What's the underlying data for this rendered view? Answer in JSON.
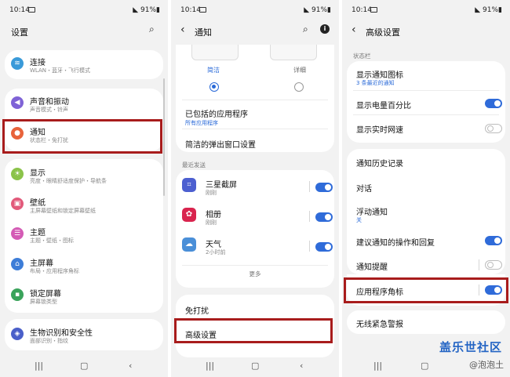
{
  "status": {
    "time": "10:14",
    "battery": "91%"
  },
  "panel1": {
    "title": "设置",
    "items": [
      {
        "icon": "wifi-icon",
        "color": "#3a9ad9",
        "title": "连接",
        "sub": "WLAN・蓝牙・飞行模式"
      },
      {
        "icon": "sound-icon",
        "color": "#7f63d6",
        "title": "声音和振动",
        "sub": "声音模式・铃声"
      },
      {
        "icon": "notification-icon",
        "color": "#e8633b",
        "title": "通知",
        "sub": "状态栏・免打扰"
      },
      {
        "icon": "display-icon",
        "color": "#8bc34a",
        "title": "显示",
        "sub": "亮度・眼睛舒适度保护・导航条"
      },
      {
        "icon": "wallpaper-icon",
        "color": "#e25a7b",
        "title": "壁纸",
        "sub": "主屏幕壁纸和锁定屏幕壁纸"
      },
      {
        "icon": "theme-icon",
        "color": "#d45bb5",
        "title": "主题",
        "sub": "主题・壁纸・图标"
      },
      {
        "icon": "home-icon",
        "color": "#3d7dd8",
        "title": "主屏幕",
        "sub": "布局・应用程序角标"
      },
      {
        "icon": "lock-icon",
        "color": "#3aa35b",
        "title": "锁定屏幕",
        "sub": "屏幕锁类型"
      },
      {
        "icon": "biometrics-icon",
        "color": "#4a5fc9",
        "title": "生物识别和安全性",
        "sub": "面部识别・指纹"
      }
    ]
  },
  "panel2": {
    "title": "通知",
    "style_brief": "简洁",
    "style_detailed": "详细",
    "included_apps_title": "已包括的应用程序",
    "included_apps_sub": "所有应用程序",
    "brief_popup": "简洁的弹出窗口设置",
    "recent_label": "最近发送",
    "recent_apps": [
      {
        "icon": "screenshot-icon",
        "color": "#4c5fd0",
        "name": "三星截屏",
        "time": "刚刚"
      },
      {
        "icon": "gallery-icon",
        "color": "#d9244e",
        "name": "相册",
        "time": "刚刚"
      },
      {
        "icon": "weather-icon",
        "color": "#4a8fd8",
        "name": "天气",
        "time": "2小时前"
      }
    ],
    "more": "更多",
    "dnd": "免打扰",
    "advanced": "高级设置"
  },
  "panel3": {
    "title": "高级设置",
    "statusbar_label": "状态栏",
    "show_icons_title": "显示通知图标",
    "show_icons_sub": "3 条最近的通知",
    "battery_pct": "显示电量百分比",
    "net_speed": "显示实时网速",
    "history": "通知历史记录",
    "conversations": "对话",
    "floating_title": "浮动通知",
    "floating_sub": "关",
    "suggest": "建议通知的操作和回复",
    "reminder": "通知提醒",
    "badges": "应用程序角标",
    "alerts": "无线紧急警报"
  },
  "watermark": {
    "brand": "盖乐世社区",
    "user": "@泡泡土"
  }
}
